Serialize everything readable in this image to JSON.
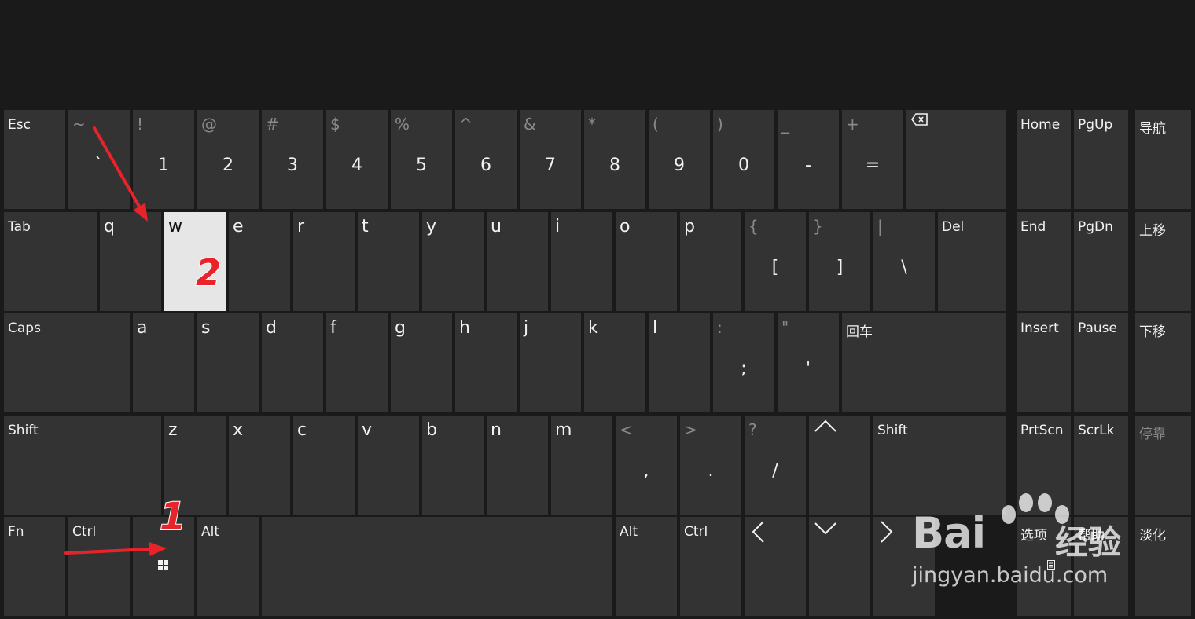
{
  "colors": {
    "background": "#1a1a1a",
    "key": "#333333",
    "key_highlight": "#e6e6e6",
    "text": "#f2f2f2",
    "text_dim": "#8a8a8a",
    "annotation": "#e8232a"
  },
  "keys": [
    {
      "id": "esc",
      "label": "Esc"
    },
    {
      "id": "backquote",
      "secondary": "~",
      "primary": "`"
    },
    {
      "id": "digit1",
      "secondary": "!",
      "primary": "1"
    },
    {
      "id": "digit2",
      "secondary": "@",
      "primary": "2"
    },
    {
      "id": "digit3",
      "secondary": "#",
      "primary": "3"
    },
    {
      "id": "digit4",
      "secondary": "$",
      "primary": "4"
    },
    {
      "id": "digit5",
      "secondary": "%",
      "primary": "5"
    },
    {
      "id": "digit6",
      "secondary": "^",
      "primary": "6"
    },
    {
      "id": "digit7",
      "secondary": "&",
      "primary": "7"
    },
    {
      "id": "digit8",
      "secondary": "*",
      "primary": "8"
    },
    {
      "id": "digit9",
      "secondary": "(",
      "primary": "9"
    },
    {
      "id": "digit0",
      "secondary": ")",
      "primary": "0"
    },
    {
      "id": "minus",
      "secondary": "_",
      "primary": "-"
    },
    {
      "id": "equal",
      "secondary": "+",
      "primary": "="
    },
    {
      "id": "backspace",
      "icon": "backspace-icon"
    },
    {
      "id": "home",
      "label": "Home"
    },
    {
      "id": "pgup",
      "label": "PgUp"
    },
    {
      "id": "nav",
      "label": "导航"
    },
    {
      "id": "tab",
      "label": "Tab"
    },
    {
      "id": "q",
      "label": "q"
    },
    {
      "id": "w",
      "label": "w",
      "highlighted": true
    },
    {
      "id": "e",
      "label": "e"
    },
    {
      "id": "r",
      "label": "r"
    },
    {
      "id": "t",
      "label": "t"
    },
    {
      "id": "y",
      "label": "y"
    },
    {
      "id": "u",
      "label": "u"
    },
    {
      "id": "i",
      "label": "i"
    },
    {
      "id": "o",
      "label": "o"
    },
    {
      "id": "p",
      "label": "p"
    },
    {
      "id": "bracketleft",
      "secondary": "{",
      "primary": "["
    },
    {
      "id": "bracketright",
      "secondary": "}",
      "primary": "]"
    },
    {
      "id": "backslash",
      "secondary": "|",
      "primary": "\\"
    },
    {
      "id": "del",
      "label": "Del"
    },
    {
      "id": "end",
      "label": "End"
    },
    {
      "id": "pgdn",
      "label": "PgDn"
    },
    {
      "id": "moveup",
      "label": "上移"
    },
    {
      "id": "caps",
      "label": "Caps"
    },
    {
      "id": "a",
      "label": "a"
    },
    {
      "id": "s",
      "label": "s"
    },
    {
      "id": "d",
      "label": "d"
    },
    {
      "id": "f",
      "label": "f"
    },
    {
      "id": "g",
      "label": "g"
    },
    {
      "id": "h",
      "label": "h"
    },
    {
      "id": "j",
      "label": "j"
    },
    {
      "id": "k",
      "label": "k"
    },
    {
      "id": "l",
      "label": "l"
    },
    {
      "id": "semicolon",
      "secondary": ":",
      "primary": ";"
    },
    {
      "id": "quote",
      "secondary": "\"",
      "primary": "'"
    },
    {
      "id": "enter",
      "label": "回车"
    },
    {
      "id": "insert",
      "label": "Insert"
    },
    {
      "id": "pause",
      "label": "Pause"
    },
    {
      "id": "movedown",
      "label": "下移"
    },
    {
      "id": "shiftleft",
      "label": "Shift"
    },
    {
      "id": "z",
      "label": "z"
    },
    {
      "id": "x",
      "label": "x"
    },
    {
      "id": "c",
      "label": "c"
    },
    {
      "id": "v",
      "label": "v"
    },
    {
      "id": "b",
      "label": "b"
    },
    {
      "id": "n",
      "label": "n"
    },
    {
      "id": "m",
      "label": "m"
    },
    {
      "id": "comma",
      "secondary": "<",
      "primary": ","
    },
    {
      "id": "period",
      "secondary": ">",
      "primary": "."
    },
    {
      "id": "slash",
      "secondary": "?",
      "primary": "/"
    },
    {
      "id": "arrowup",
      "icon": "arrow-up-icon"
    },
    {
      "id": "shiftright",
      "label": "Shift"
    },
    {
      "id": "prtscn",
      "label": "PrtScn"
    },
    {
      "id": "scrlk",
      "label": "ScrLk"
    },
    {
      "id": "dock",
      "label": "停靠",
      "dim": true
    },
    {
      "id": "fn",
      "label": "Fn"
    },
    {
      "id": "ctrlleft",
      "label": "Ctrl"
    },
    {
      "id": "win",
      "icon": "windows-logo-icon"
    },
    {
      "id": "altleft",
      "label": "Alt"
    },
    {
      "id": "space",
      "label": ""
    },
    {
      "id": "altright",
      "label": "Alt"
    },
    {
      "id": "ctrlright",
      "label": "Ctrl"
    },
    {
      "id": "arrowleft",
      "icon": "arrow-left-icon"
    },
    {
      "id": "arrowdown",
      "icon": "arrow-down-icon"
    },
    {
      "id": "arrowright",
      "icon": "arrow-right-icon"
    },
    {
      "id": "options",
      "label": "选项",
      "icon": "menu-icon"
    },
    {
      "id": "help",
      "label": "帮助"
    },
    {
      "id": "fade",
      "label": "淡化"
    }
  ],
  "annotations": {
    "step1": "1",
    "step2": "2"
  },
  "watermark": {
    "brand": "Bai",
    "brand_cn": "经验",
    "url": "jingyan.baidu.com"
  }
}
